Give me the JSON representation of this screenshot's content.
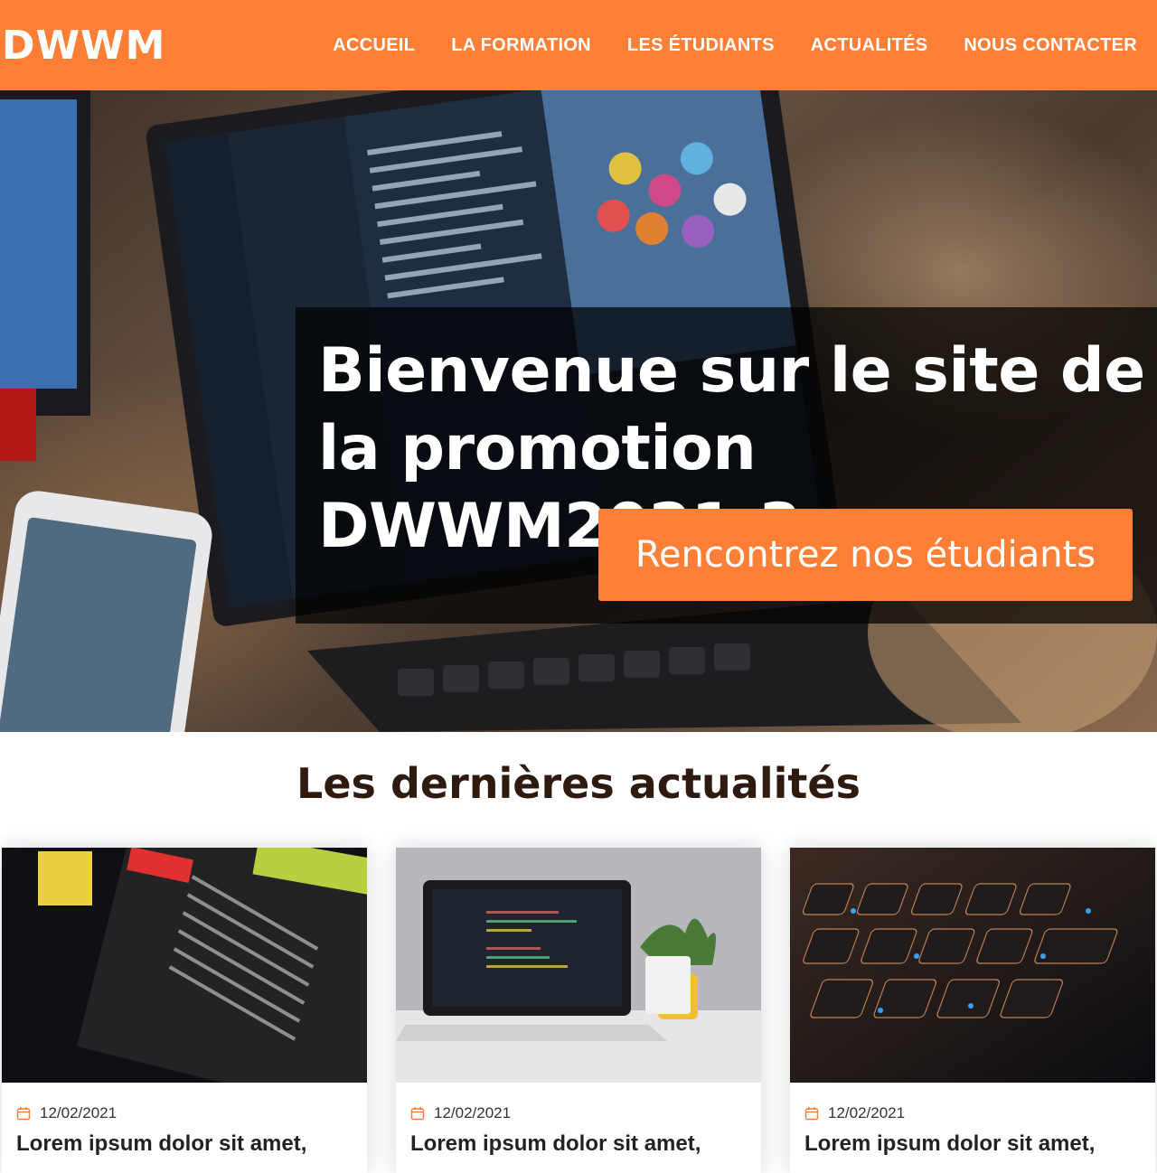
{
  "brand": {
    "logo": "DWWM",
    "accent": "#ff7f36"
  },
  "nav": {
    "items": [
      {
        "label": "ACCUEIL"
      },
      {
        "label": "LA FORMATION"
      },
      {
        "label": "LES ÉTUDIANTS"
      },
      {
        "label": "ACTUALITÉS"
      },
      {
        "label": "NOUS CONTACTER"
      }
    ]
  },
  "hero": {
    "title": "Bienvenue sur le site de la promotion DWWM2021-3",
    "button_label": "Rencontrez nos étudiants"
  },
  "news": {
    "heading": "Les dernières actualités",
    "cards": [
      {
        "date": "12/02/2021",
        "title": "Lorem ipsum dolor sit amet,"
      },
      {
        "date": "12/02/2021",
        "title": "Lorem ipsum dolor sit amet,"
      },
      {
        "date": "12/02/2021",
        "title": "Lorem ipsum dolor sit amet,"
      }
    ]
  }
}
